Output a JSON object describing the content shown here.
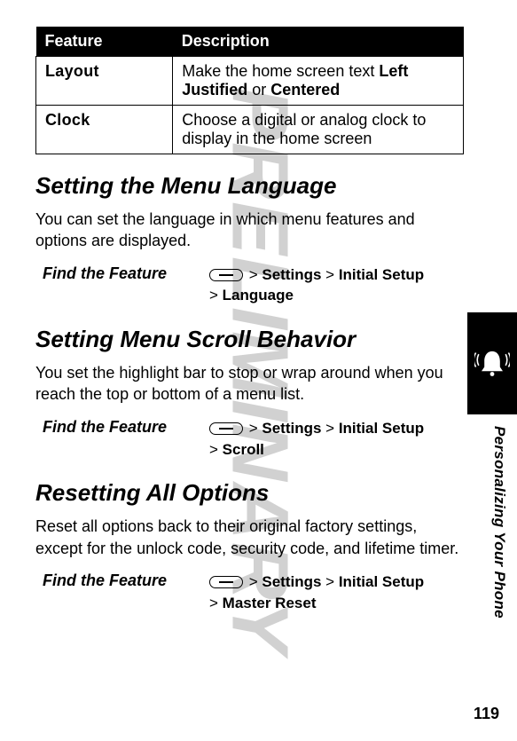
{
  "watermark": "PRELIMINARY",
  "table": {
    "header": {
      "feature": "Feature",
      "description": "Description"
    },
    "rows": [
      {
        "feature": "Layout",
        "desc_prefix": "Make the home screen text ",
        "opt1": "Left Justified",
        "conj": " or ",
        "opt2": "Centered"
      },
      {
        "feature": "Clock",
        "desc": "Choose a digital or analog clock to display in the home screen"
      }
    ]
  },
  "sections": {
    "language": {
      "heading": "Setting the Menu Language",
      "body": "You can set the language in which menu features and options are displayed.",
      "find_label": "Find the Feature",
      "path1_sep1": " > ",
      "path1_step1": "Settings",
      "path1_sep2": " > ",
      "path1_step2": "Initial Setup",
      "path2_sep1": "> ",
      "path2_step1": "Language"
    },
    "scroll": {
      "heading": "Setting Menu Scroll Behavior",
      "body": "You set the highlight bar to stop or wrap around when you reach the top or bottom of a menu list.",
      "find_label": "Find the Feature",
      "path1_sep1": " > ",
      "path1_step1": "Settings",
      "path1_sep2": " > ",
      "path1_step2": "Initial Setup",
      "path2_sep1": "> ",
      "path2_step1": "Scroll"
    },
    "reset": {
      "heading": "Resetting All Options",
      "body": "Reset all options back to their original factory settings, except for the unlock code, security code, and lifetime timer.",
      "find_label": "Find the Feature",
      "path1_sep1": " > ",
      "path1_step1": "Settings",
      "path1_sep2": " > ",
      "path1_step2": "Initial Setup",
      "path2_sep1": "> ",
      "path2_step1": "Master Reset"
    }
  },
  "side_label": "Personalizing Your Phone",
  "page_number": "119"
}
